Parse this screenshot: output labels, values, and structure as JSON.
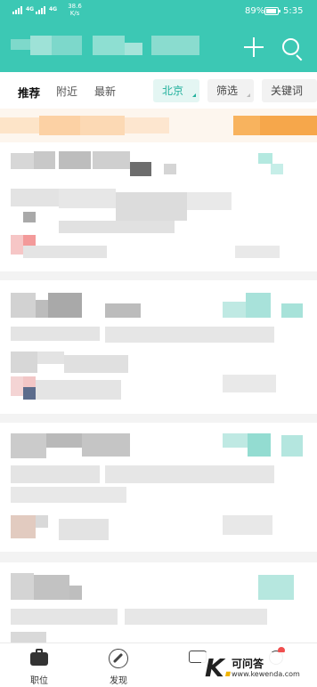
{
  "status_bar": {
    "signal1_label": "4G",
    "signal2_label": "4G",
    "net_speed_value": "38.6",
    "net_speed_unit": "K/s",
    "battery": "89%",
    "time": "5:35"
  },
  "header": {
    "title_hidden": "",
    "plus_icon": "plus-icon",
    "search_icon": "search-icon"
  },
  "tabs": [
    {
      "label": "推荐",
      "active": true
    },
    {
      "label": "附近",
      "active": false
    },
    {
      "label": "最新",
      "active": false
    }
  ],
  "filters": {
    "city": "北京",
    "screen": "筛选",
    "keyword": "关键词"
  },
  "bottom_nav": [
    {
      "label": "职位",
      "icon": "briefcase-icon"
    },
    {
      "label": "发现",
      "icon": "compass-icon"
    },
    {
      "label": "",
      "icon": "message-icon"
    },
    {
      "label": "",
      "icon": "profile-icon"
    }
  ],
  "watermark": {
    "brand": "可问答",
    "url": "www.kewenda.com"
  },
  "colors": {
    "accent": "#3cc8b4",
    "city_text": "#20b09c",
    "badge": "#f04f4f"
  }
}
